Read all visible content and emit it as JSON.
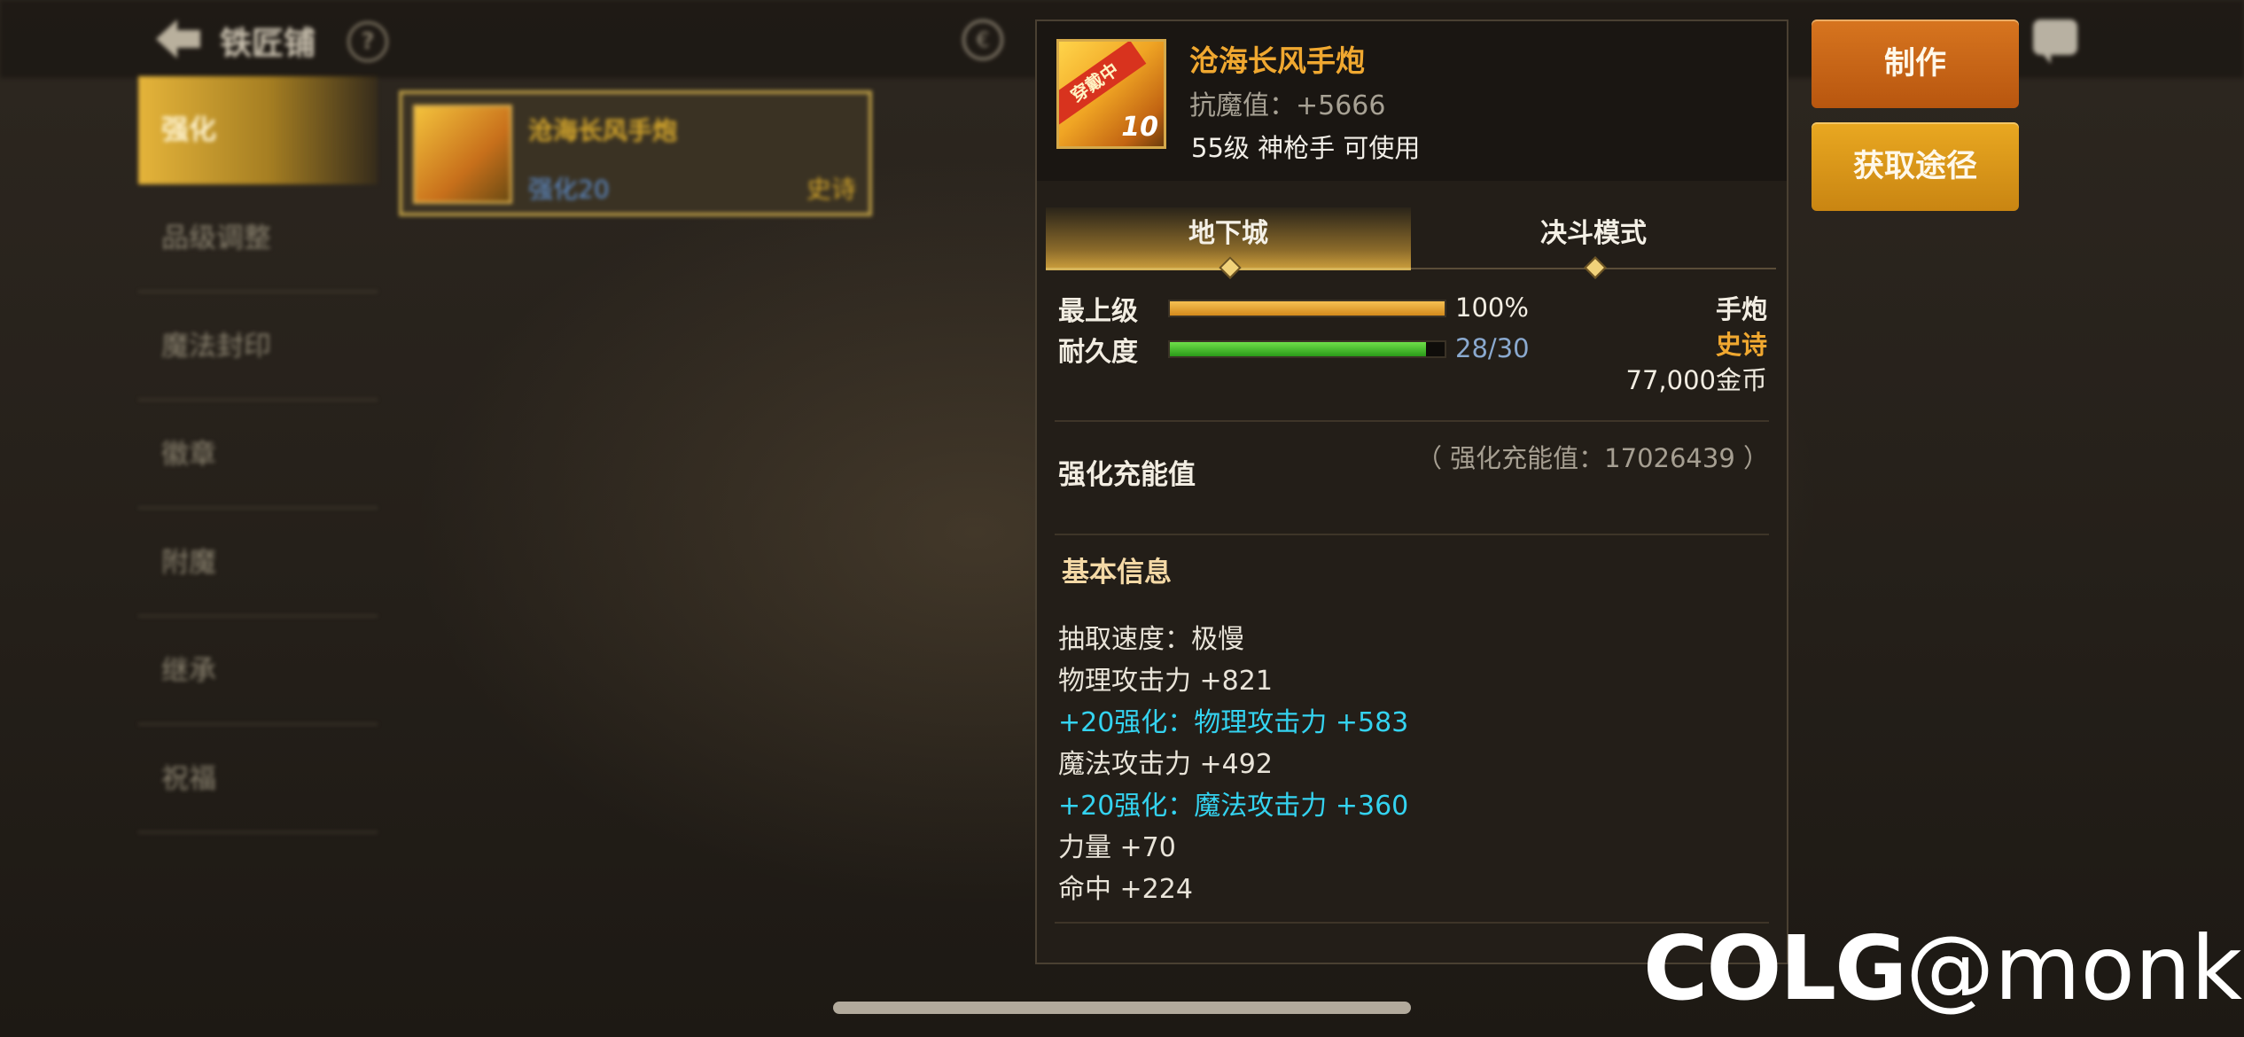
{
  "header": {
    "title": "铁匠铺",
    "help": "?"
  },
  "sidebar": {
    "items": [
      {
        "label": "强化"
      },
      {
        "label": "品级调整"
      },
      {
        "label": "魔法封印"
      },
      {
        "label": "徽章"
      },
      {
        "label": "附魔"
      },
      {
        "label": "继承"
      },
      {
        "label": "祝福"
      }
    ]
  },
  "list_item": {
    "name": "沧海长风手炮",
    "level": "强化20",
    "grade": "史诗"
  },
  "item": {
    "name": "沧海长风手炮",
    "stat": "抗魔值：+5666",
    "requirement": "55级 神枪手 可使用",
    "badge_text": "穿戴中",
    "badge_level": "10",
    "tabs": [
      "地下城",
      "决斗模式"
    ],
    "max_level_label": "最上级",
    "max_level_value": "100%",
    "max_level_fraction": 1.0,
    "durability_label": "耐久度",
    "durability_value": "28/30",
    "durability_fraction": 0.933,
    "type": "手炮",
    "rarity": "史诗",
    "price": "77,000金币",
    "charge_label": "强化充能值",
    "charge_value": "（ 强化充能值：17026439 ）",
    "section_title": "基本信息",
    "attributes": [
      {
        "text": "抽取速度：极慢",
        "type": "normal"
      },
      {
        "text": "物理攻击力 +821",
        "type": "normal"
      },
      {
        "text": "+20强化：物理攻击力 +583",
        "type": "bonus"
      },
      {
        "text": "魔法攻击力 +492",
        "type": "normal"
      },
      {
        "text": "+20强化：魔法攻击力 +360",
        "type": "bonus"
      },
      {
        "text": "力量 +70",
        "type": "normal"
      },
      {
        "text": "命中 +224",
        "type": "normal"
      }
    ]
  },
  "buttons": {
    "make": "制作",
    "source": "获取途径"
  },
  "watermark": {
    "brand": "COLG",
    "handle": "@monkof"
  },
  "colors": {
    "accent_gold": "#f0a830",
    "bonus_cyan": "#34d3f0",
    "rarity_epic": "#f0a830"
  }
}
